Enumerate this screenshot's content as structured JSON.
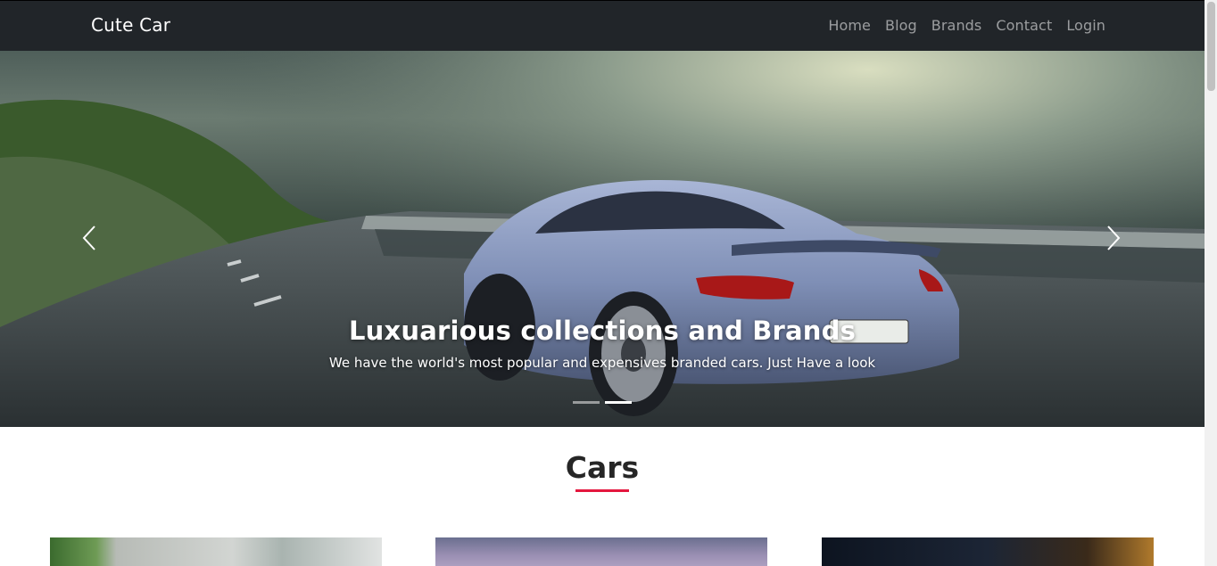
{
  "navbar": {
    "brand": "Cute Car",
    "links": [
      "Home",
      "Blog",
      "Brands",
      "Contact",
      "Login"
    ]
  },
  "carousel": {
    "heading": "Luxuarious collections and Brands",
    "subtext": "We have the world's most popular and expensives branded cars. Just Have a look",
    "slide_count": 2,
    "active_slide": 2,
    "prev_icon": "chevron-left-icon",
    "next_icon": "chevron-right-icon"
  },
  "section": {
    "title": "Cars",
    "accent_color": "#e4173e"
  },
  "cards": [
    {
      "name": "car-card-1"
    },
    {
      "name": "car-card-2"
    },
    {
      "name": "car-card-3"
    }
  ],
  "colors": {
    "navbar_bg": "#212529",
    "nav_link": "rgba(255,255,255,0.55)",
    "brand": "#ffffff"
  }
}
